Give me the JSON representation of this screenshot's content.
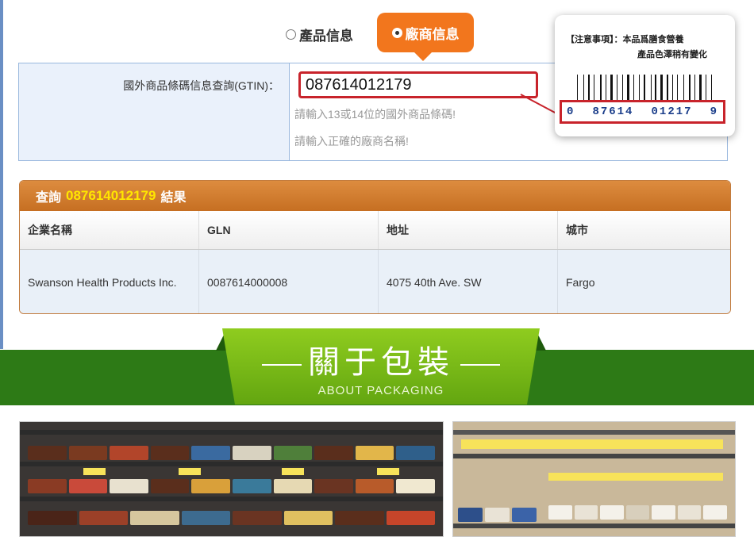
{
  "tabs": {
    "product_label": "產品信息",
    "manufacturer_label": "廠商信息",
    "selected": "manufacturer"
  },
  "search": {
    "label": "國外商品條碼信息查詢(GTIN)：",
    "value": "087614012179",
    "hint_digits": "請輸入13或14位的國外商品條碼!",
    "hint_name": "請輸入正確的廠商名稱!"
  },
  "notice": {
    "line1": "【注意事項】：本品爲膳食營養",
    "line2": "產品色澤稍有變化",
    "barcode_digits": [
      "0",
      "87614",
      "01217",
      "9"
    ]
  },
  "results": {
    "title_prefix": "查詢",
    "title_code": "087614012179",
    "title_suffix": "結果",
    "columns": [
      "企業名稱",
      "GLN",
      "地址",
      "城市"
    ],
    "rows": [
      [
        "Swanson Health Products Inc.",
        "0087614000008",
        "4075 40th Ave. SW",
        "Fargo"
      ]
    ]
  },
  "banner": {
    "title": "關于包裝",
    "subtitle": "ABOUT PACKAGING"
  },
  "colors": {
    "accent_orange": "#f2761d",
    "highlight_red": "#c8232b",
    "banner_green": "#2d7a16",
    "ribbon_green": "#7dbb18",
    "code_yellow": "#ffe600"
  }
}
